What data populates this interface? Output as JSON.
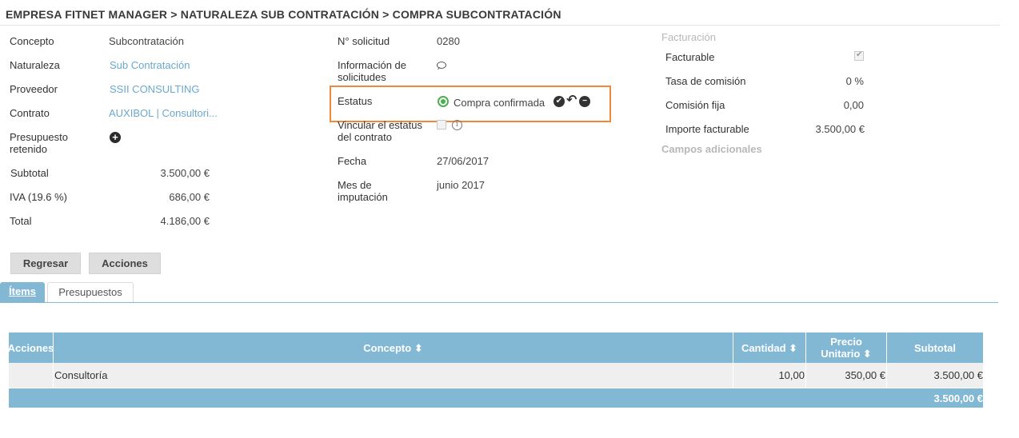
{
  "breadcrumb": "EMPRESA FITNET MANAGER > NATURALEZA SUB CONTRATACIÓN > COMPRA SUBCONTRATACIÓN",
  "left": {
    "concepto_label": "Concepto",
    "concepto_value": "Subcontratación",
    "naturaleza_label": "Naturaleza",
    "naturaleza_value": "Sub Contratación",
    "proveedor_label": "Proveedor",
    "proveedor_value": "SSII CONSULTING",
    "contrato_label": "Contrato",
    "contrato_value": "AUXIBOL | Consultori...",
    "presupuesto_label_1": "Presupuesto",
    "presupuesto_label_2": "retenido",
    "subtotal_label": "Subtotal",
    "subtotal_value": "3.500,00 €",
    "iva_label": "IVA (19.6 %)",
    "iva_value": "686,00 €",
    "total_label": "Total",
    "total_value": "4.186,00 €"
  },
  "middle": {
    "solicitud_label": "N° solicitud",
    "solicitud_value": "0280",
    "info_label_1": "Información de",
    "info_label_2": "solicitudes",
    "estatus_label": "Estatus",
    "estatus_value": "Compra confirmada",
    "vincular_label_1": "Vincular el estatus",
    "vincular_label_2": "del contrato",
    "fecha_label": "Fecha",
    "fecha_value": "27/06/2017",
    "mes_label_1": "Mes de",
    "mes_label_2": "imputación",
    "mes_value": "junio 2017"
  },
  "right": {
    "facturacion_header": "Facturación",
    "facturable_label": "Facturable",
    "facturable_checked": true,
    "tasa_label": "Tasa de comisión",
    "tasa_value": "0 %",
    "comision_label": "Comisión fija",
    "comision_value": "0,00",
    "importe_label": "Importe facturable",
    "importe_value": "3.500,00 €",
    "campos_header": "Campos adicionales"
  },
  "buttons": {
    "regresar": "Regresar",
    "acciones": "Acciones"
  },
  "tabs": {
    "items": "Ítems",
    "presupuestos": "Presupuestos"
  },
  "table": {
    "headers": {
      "acciones": "Acciones",
      "concepto": "Concepto ⬍",
      "cantidad": "Cantidad ⬍",
      "precio_1": "Precio",
      "precio_2": "Unitario ⬍",
      "subtotal": "Subtotal"
    },
    "rows": [
      {
        "concepto": "Consultoría",
        "cantidad": "10,00",
        "precio": "350,00 €",
        "subtotal": "3.500,00 €"
      }
    ],
    "total": "3.500,00 €"
  },
  "colors": {
    "accent": "#82b8d4",
    "link": "#6aa9cc",
    "status_green": "#4caf50",
    "highlight_orange": "#f08a3a"
  }
}
